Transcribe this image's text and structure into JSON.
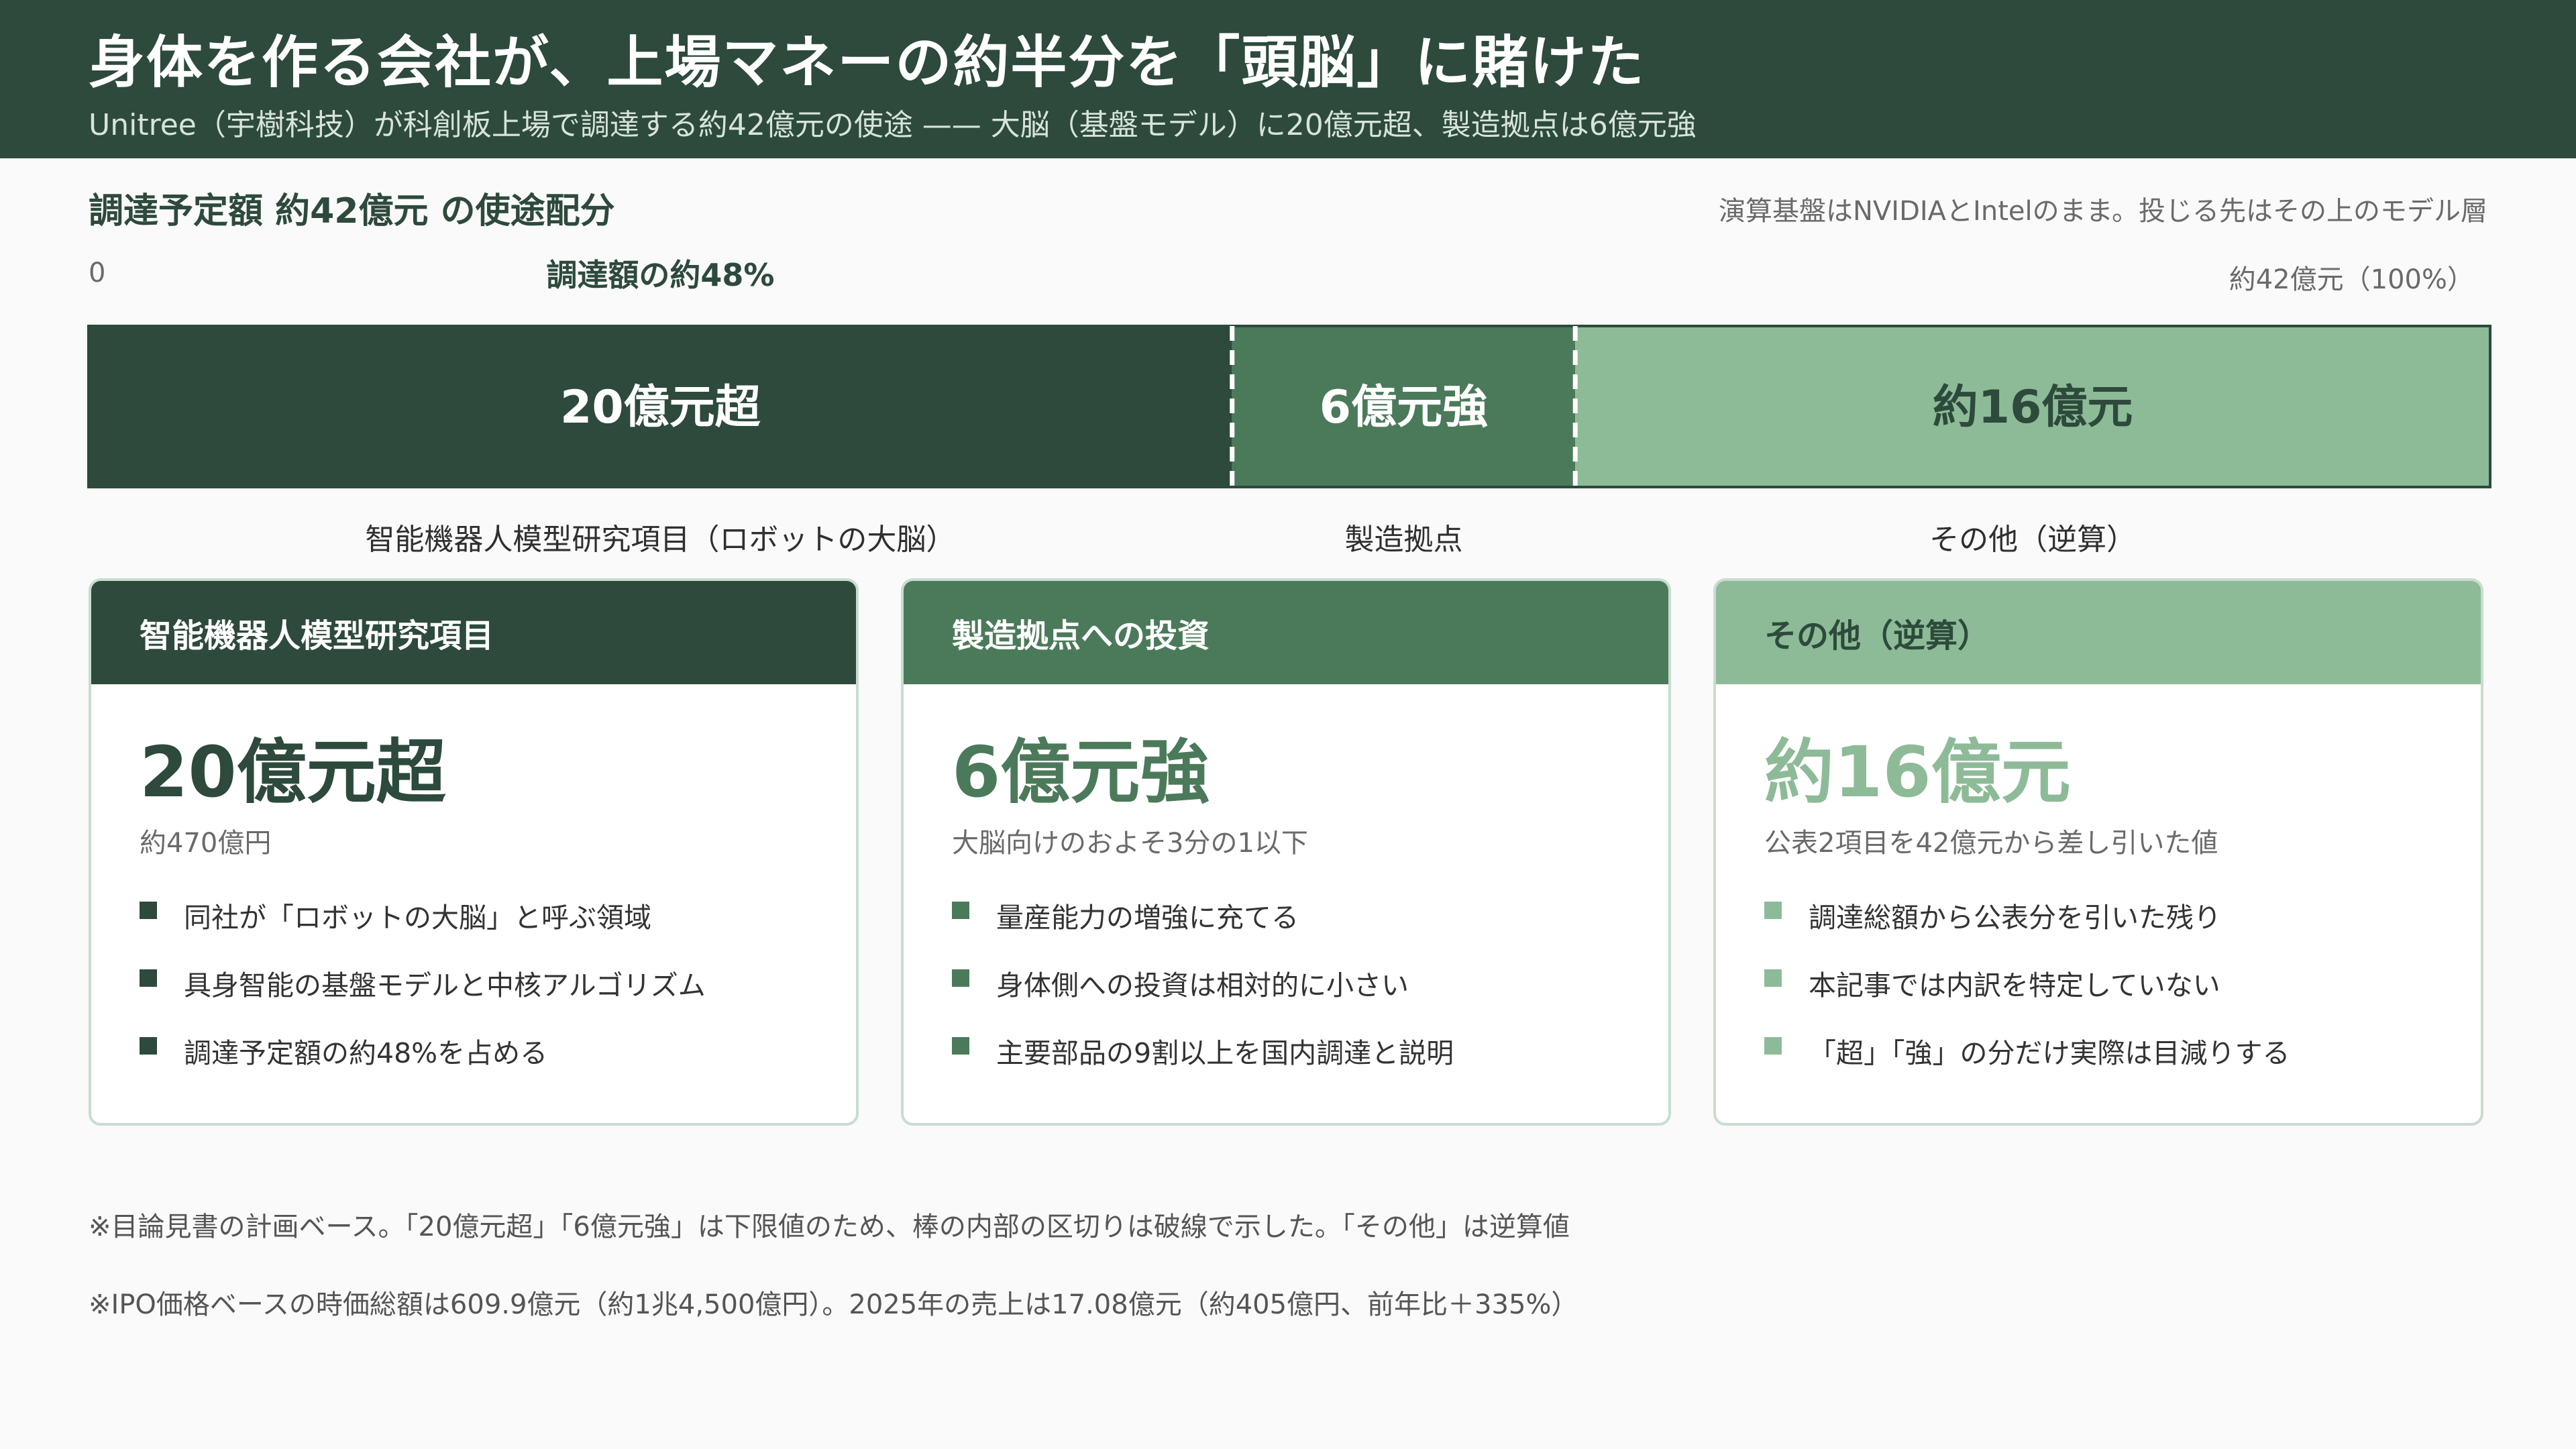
{
  "header": {
    "title": "身体を作る会社が、上場マネーの約半分を「頭脳」に賭けた",
    "subtitle": "Unitree（宇樹科技）が科創板上場で調達する約42億元の使途 —— 大脳（基盤モデル）に20億元超、製造拠点は6億元強"
  },
  "section": {
    "title": "調達予定額 約42億元 の使途配分",
    "note": "演算基盤はNVIDIAとIntelのまま。投じる先はその上のモデル層"
  },
  "chart_data": {
    "type": "bar",
    "orientation": "horizontal-stacked",
    "total": 42,
    "unit": "億元",
    "axis_labels": {
      "min": "0",
      "max": "約42億元（100%）"
    },
    "annotation": "調達額の約48%",
    "categories": [
      "智能機器人模型研究項目（ロボットの大脳）",
      "製造拠点",
      "その他（逆算）"
    ],
    "values": [
      20,
      6,
      16
    ],
    "value_labels": [
      "20億元超",
      "6億元強",
      "約16億元"
    ],
    "colors": [
      "#2d4a3c",
      "#4b7a5a",
      "#8dbb97"
    ],
    "label_colors": [
      "#ffffff",
      "#ffffff",
      "#2d4a3c"
    ],
    "dashed_dividers": true
  },
  "cards": [
    {
      "heading": "智能機器人模型研究項目",
      "big": "20億元超",
      "sub": "約470億円",
      "items": [
        "同社が「ロボットの大脳」と呼ぶ領域",
        "具身智能の基盤モデルと中核アルゴリズム",
        "調達予定額の約48%を占める"
      ],
      "head_bg": "#2d4a3c",
      "head_fg": "#ffffff",
      "accent": "#2d4a3c"
    },
    {
      "heading": "製造拠点への投資",
      "big": "6億元強",
      "sub": "大脳向けのおよそ3分の1以下",
      "items": [
        "量産能力の増強に充てる",
        "身体側への投資は相対的に小さい",
        "主要部品の9割以上を国内調達と説明"
      ],
      "head_bg": "#4b7a5a",
      "head_fg": "#ffffff",
      "accent": "#4b7a5a"
    },
    {
      "heading": "その他（逆算）",
      "big": "約16億元",
      "sub": "公表2項目を42億元から差し引いた値",
      "items": [
        "調達総額から公表分を引いた残り",
        "本記事では内訳を特定していない",
        "「超」「強」の分だけ実際は目減りする"
      ],
      "head_bg": "#8dbb97",
      "head_fg": "#2d4a3c",
      "accent": "#8dbb97"
    }
  ],
  "footnotes": [
    "※目論見書の計画ベース。「20億元超」「6億元強」は下限値のため、棒の内部の区切りは破線で示した。「その他」は逆算値",
    "※IPO価格ベースの時価総額は609.9億元（約1兆4,500億円）。2025年の売上は17.08億元（約405億円、前年比＋335%）"
  ]
}
